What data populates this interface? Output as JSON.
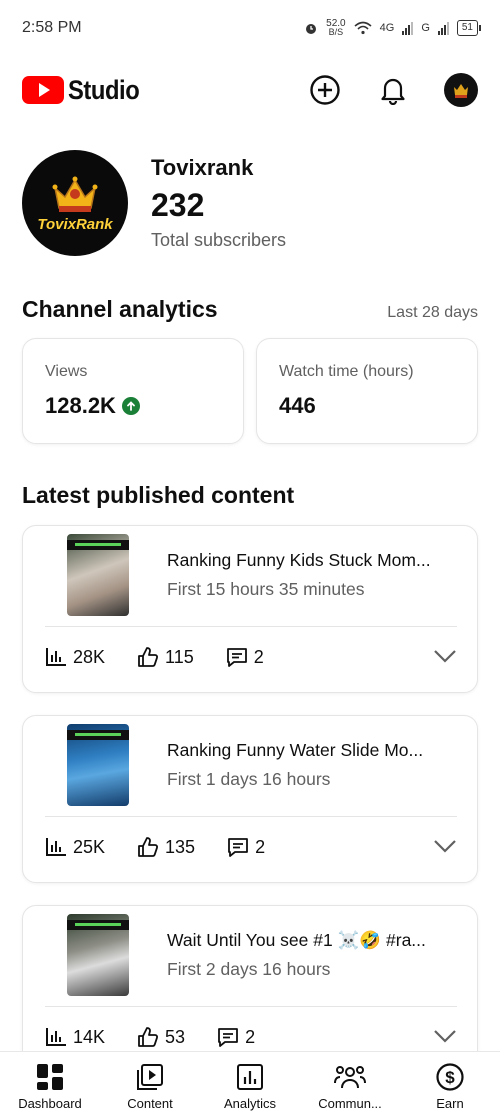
{
  "status_bar": {
    "time": "2:58 PM",
    "net_speed": "52.0",
    "net_unit": "B/S",
    "network_1": "4G",
    "network_2": "G",
    "battery": "51"
  },
  "app": {
    "name": "Studio",
    "brand_color": "#ff0000"
  },
  "channel": {
    "name": "Tovixrank",
    "avatar_text": "TovixRank",
    "subscribers": "232",
    "subscribers_label": "Total subscribers"
  },
  "analytics": {
    "title": "Channel analytics",
    "period": "Last 28 days",
    "cards": [
      {
        "label": "Views",
        "value": "128.2K",
        "trend": "up",
        "trend_color": "#1a7f37"
      },
      {
        "label": "Watch time (hours)",
        "value": "446"
      }
    ]
  },
  "latest": {
    "title": "Latest published content",
    "videos": [
      {
        "title": "Ranking Funny Kids Stuck Mom...",
        "subtitle": "First 15 hours 35 minutes",
        "views": "28K",
        "likes": "115",
        "comments": "2"
      },
      {
        "title": "Ranking Funny Water Slide Mo...",
        "subtitle": "First 1 days 16 hours",
        "views": "25K",
        "likes": "135",
        "comments": "2"
      },
      {
        "title": "Wait Until You see #1 ☠️🤣 #ra...",
        "subtitle": "First 2 days 16 hours",
        "views": "14K",
        "likes": "53",
        "comments": "2"
      }
    ]
  },
  "nav": [
    {
      "label": "Dashboard",
      "icon": "dashboard-icon",
      "active": true
    },
    {
      "label": "Content",
      "icon": "content-icon"
    },
    {
      "label": "Analytics",
      "icon": "analytics-icon"
    },
    {
      "label": "Commun...",
      "icon": "community-icon"
    },
    {
      "label": "Earn",
      "icon": "earn-icon"
    }
  ]
}
